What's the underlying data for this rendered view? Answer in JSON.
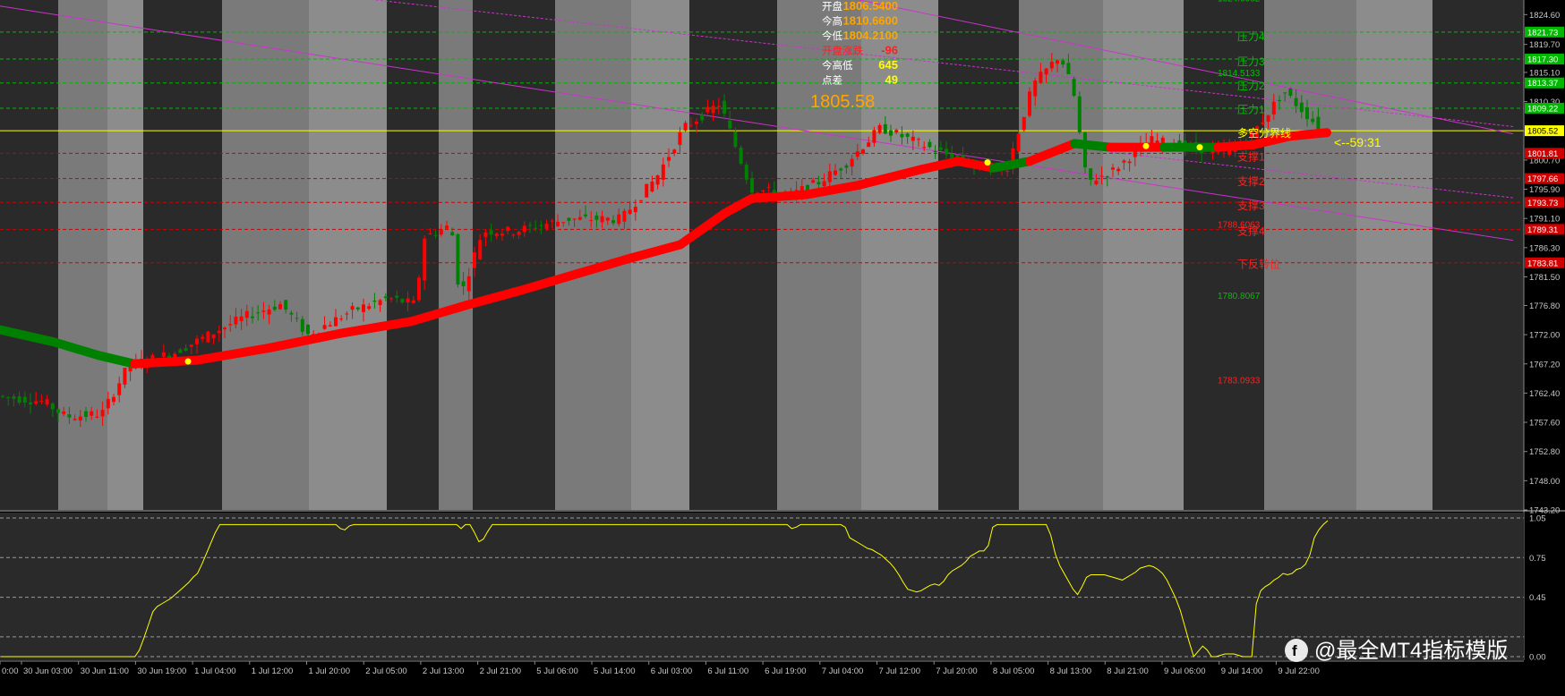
{
  "chart_data": [
    {
      "type": "candlestick",
      "ylim": [
        1743.2,
        1827.0
      ],
      "y_ticks": [
        "1824.60",
        "1819.70",
        "1815.10",
        "1810.30",
        "1805.40",
        "1800.70",
        "1795.90",
        "1791.10",
        "1786.30",
        "1781.50",
        "1776.80",
        "1772.00",
        "1767.20",
        "1762.40",
        "1757.60",
        "1752.80",
        "1748.00",
        "1743.20"
      ],
      "x_ticks": [
        "0:00",
        "30 Jun 03:00",
        "30 Jun 11:00",
        "30 Jun 19:00",
        "1 Jul 04:00",
        "1 Jul 12:00",
        "1 Jul 20:00",
        "2 Jul 05:00",
        "2 Jul 13:00",
        "2 Jul 21:00",
        "5 Jul 06:00",
        "5 Jul 14:00",
        "6 Jul 03:00",
        "6 Jul 11:00",
        "6 Jul 19:00",
        "7 Jul 04:00",
        "7 Jul 12:00",
        "7 Jul 20:00",
        "8 Jul 05:00",
        "8 Jul 13:00",
        "8 Jul 21:00",
        "9 Jul 06:00",
        "9 Jul 14:00",
        "9 Jul 22:00"
      ],
      "current_price": "1805.52",
      "current_price_big": "1805.58",
      "countdown": "<--59:31",
      "price_tags": [
        {
          "value": "1821.73",
          "price": 1821.73,
          "color": "#00b800"
        },
        {
          "value": "1817.30",
          "price": 1817.3,
          "color": "#00b800"
        },
        {
          "value": "1813.37",
          "price": 1813.37,
          "color": "#00b800"
        },
        {
          "value": "1809.22",
          "price": 1809.22,
          "color": "#00b800"
        },
        {
          "value": "1801.81",
          "price": 1801.81,
          "color": "#d00000"
        },
        {
          "value": "1797.66",
          "price": 1797.66,
          "color": "#d00000"
        },
        {
          "value": "1793.73",
          "price": 1793.73,
          "color": "#d00000"
        },
        {
          "value": "1789.31",
          "price": 1789.31,
          "color": "#d00000"
        },
        {
          "value": "1783.81",
          "price": 1783.81,
          "color": "#d00000"
        }
      ],
      "level_labels": [
        {
          "text": "压力4",
          "price": 1820.4,
          "color": "#00c000"
        },
        {
          "text": "压力3",
          "price": 1816.3,
          "color": "#00c000"
        },
        {
          "text": "压力2",
          "price": 1812.3,
          "color": "#00c000"
        },
        {
          "text": "压力1",
          "price": 1808.4,
          "color": "#00c000"
        },
        {
          "text": "多空分界线",
          "price": 1804.5,
          "color": "#ffff00"
        },
        {
          "text": "支撑1",
          "price": 1800.6,
          "color": "#ff2020"
        },
        {
          "text": "支撑2",
          "price": 1796.6,
          "color": "#ff2020"
        },
        {
          "text": "支撑3",
          "price": 1792.6,
          "color": "#ff2020"
        },
        {
          "text": "支撑4",
          "price": 1788.4,
          "color": "#ff2020"
        },
        {
          "text": "下反转位",
          "price": 1783.0,
          "color": "#ff2020"
        }
      ],
      "side_values": [
        {
          "text": "1824.6062",
          "price": 1826.8,
          "color": "#00c000"
        },
        {
          "text": "1814.5133",
          "price": 1814.5,
          "color": "#00c000"
        },
        {
          "text": "1788.6063",
          "price": 1789.6,
          "color": "#ff2020"
        },
        {
          "text": "1780.8067",
          "price": 1777.9,
          "color": "#00c000"
        },
        {
          "text": "1783.0933",
          "price": 1764.0,
          "color": "#ff2020"
        }
      ],
      "info_panel": [
        {
          "label": "开盘",
          "value": "1806.5400",
          "label_color": "#ffffff",
          "value_color": "#ffa500"
        },
        {
          "label": "今高",
          "value": "1810.6600",
          "label_color": "#ffffff",
          "value_color": "#ffa500"
        },
        {
          "label": "今低",
          "value": "1804.2100",
          "label_color": "#ffffff",
          "value_color": "#ffa500"
        },
        {
          "label": "开盘涨跌",
          "value": "-96",
          "label_color": "#ff2020",
          "value_color": "#ff2020"
        },
        {
          "label": "今高低",
          "value": "645",
          "label_color": "#ffffff",
          "value_color": "#ffff00"
        },
        {
          "label": "点差",
          "value": "49",
          "label_color": "#ffffff",
          "value_color": "#ffff00"
        }
      ],
      "colors": {
        "up": "#ff0000",
        "down": "#008000",
        "trend_up": "#ff0000",
        "trend_down": "#008000",
        "channel": "#cc33cc",
        "current": "#ffff00",
        "band_light": "#7a7a7a",
        "band_dark": "#2a2a2a"
      },
      "candles": []
    },
    {
      "type": "line",
      "ylim": [
        0.0,
        1.05
      ],
      "y_ticks": [
        "1.05",
        "0.75",
        "0.45",
        "0.00"
      ],
      "series": [
        {
          "color": "#ffff00",
          "values": [
            0.0,
            0.0,
            0.0,
            0.0,
            0.0,
            0.0,
            0.0,
            0.0,
            0.0,
            0.0,
            0.0,
            0.0,
            0.0,
            0.0,
            0.0,
            0.0,
            0.0,
            0.0,
            0.0,
            0.0,
            0.0,
            0.0,
            0.0,
            0.0,
            0.0,
            0.0,
            0.0,
            0.0,
            0.0,
            0.0,
            0.0,
            0.05,
            0.14,
            0.24,
            0.34,
            0.38,
            0.4,
            0.42,
            0.44,
            0.47,
            0.5,
            0.53,
            0.56,
            0.6,
            0.63,
            0.7,
            0.78,
            0.86,
            0.94,
            1.0,
            1.0,
            1.0,
            1.0,
            1.0,
            1.0,
            1.0,
            1.0,
            1.0,
            1.0,
            1.0,
            1.0,
            1.0,
            1.0,
            1.0,
            1.0,
            1.0,
            1.0,
            1.0,
            1.0,
            1.0,
            1.0,
            1.0,
            1.0,
            1.0,
            1.0,
            1.0,
            0.97,
            0.96,
            0.99,
            1.0,
            1.0,
            1.0,
            1.0,
            1.0,
            1.0,
            1.0,
            1.0,
            1.0,
            1.0,
            1.0,
            1.0,
            1.0,
            1.0,
            1.0,
            1.0,
            1.0,
            1.0,
            1.0,
            1.0,
            1.0,
            1.0,
            1.0,
            1.0,
            0.97,
            1.0,
            1.0,
            0.94,
            0.87,
            0.89,
            0.95,
            1.0,
            1.0,
            1.0,
            1.0,
            1.0,
            1.0,
            1.0,
            1.0,
            1.0,
            1.0,
            1.0,
            1.0,
            1.0,
            1.0,
            1.0,
            1.0,
            1.0,
            1.0,
            1.0,
            1.0,
            1.0,
            1.0,
            1.0,
            1.0,
            1.0,
            1.0,
            1.0,
            1.0,
            1.0,
            1.0,
            1.0,
            1.0,
            1.0,
            1.0,
            1.0,
            1.0,
            1.0,
            1.0,
            1.0,
            1.0,
            1.0,
            1.0,
            1.0,
            1.0,
            1.0,
            1.0,
            1.0,
            1.0,
            1.0,
            1.0,
            1.0,
            1.0,
            1.0,
            1.0,
            1.0,
            1.0,
            1.0,
            1.0,
            1.0,
            1.0,
            1.0,
            1.0,
            1.0,
            1.0,
            1.0,
            1.0,
            1.0,
            0.97,
            0.98,
            1.0,
            1.0,
            1.0,
            1.0,
            1.0,
            1.0,
            1.0,
            1.0,
            1.0,
            1.0,
            0.98,
            0.9,
            0.88,
            0.86,
            0.84,
            0.82,
            0.81,
            0.79,
            0.77,
            0.74,
            0.71,
            0.67,
            0.62,
            0.56,
            0.51,
            0.5,
            0.49,
            0.5,
            0.52,
            0.54,
            0.55,
            0.54,
            0.57,
            0.62,
            0.65,
            0.67,
            0.69,
            0.72,
            0.76,
            0.78,
            0.8,
            0.8,
            0.84,
            0.98,
            1.0,
            1.0,
            1.0,
            1.0,
            1.0,
            1.0,
            1.0,
            1.0,
            1.0,
            1.0,
            1.0,
            1.0,
            0.92,
            0.78,
            0.69,
            0.63,
            0.57,
            0.51,
            0.47,
            0.53,
            0.6,
            0.62,
            0.62,
            0.62,
            0.62,
            0.61,
            0.6,
            0.59,
            0.58,
            0.6,
            0.62,
            0.64,
            0.67,
            0.68,
            0.69,
            0.68,
            0.66,
            0.63,
            0.58,
            0.51,
            0.44,
            0.35,
            0.23,
            0.11,
            0.0,
            0.04,
            0.08,
            0.05,
            0.0,
            0.0,
            0.01,
            0.02,
            0.02,
            0.02,
            0.01,
            0.0,
            0.0,
            0.0,
            0.4,
            0.5,
            0.53,
            0.55,
            0.58,
            0.6,
            0.63,
            0.62,
            0.63,
            0.66,
            0.67,
            0.7,
            0.77,
            0.9,
            0.96,
            1.0,
            1.03
          ]
        }
      ]
    }
  ],
  "watermark": {
    "text": "@最全MT4指标模版",
    "icon": "brand-logo-icon"
  }
}
